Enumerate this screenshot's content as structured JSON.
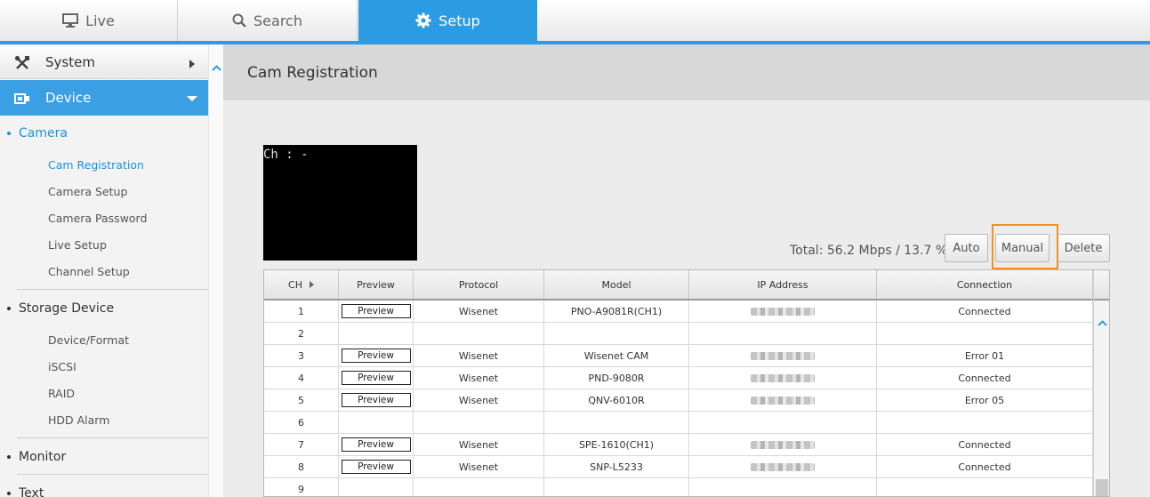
{
  "top_tabs": [
    {
      "label": "Live",
      "icon": "monitor-icon"
    },
    {
      "label": "Search",
      "icon": "search-icon"
    },
    {
      "label": "Setup",
      "icon": "gear-icon",
      "active": true
    }
  ],
  "sidebar": {
    "system_label": "System",
    "device_label": "Device",
    "groups": [
      {
        "label": "Camera",
        "active": true,
        "items": [
          "Cam Registration",
          "Camera Setup",
          "Camera Password",
          "Live Setup",
          "Channel Setup"
        ]
      },
      {
        "label": "Storage Device",
        "items": [
          "Device/Format",
          "iSCSI",
          "RAID",
          "HDD Alarm"
        ]
      },
      {
        "label": "Monitor",
        "items": []
      },
      {
        "label": "Text",
        "items": []
      }
    ]
  },
  "main": {
    "title": "Cam Registration",
    "preview_label": "Ch : -",
    "total": "Total: 56.2 Mbps / 13.7 %",
    "buttons": {
      "auto": "Auto",
      "manual": "Manual",
      "delete": "Delete"
    }
  },
  "table": {
    "columns": [
      "CH",
      "Preview",
      "Protocol",
      "Model",
      "IP Address",
      "Connection"
    ],
    "preview_button_label": "Preview",
    "rows": [
      {
        "ch": "1",
        "has_preview": true,
        "protocol": "Wisenet",
        "model": "PNO-A9081R(CH1)",
        "ip_blurred": true,
        "connection": "Connected"
      },
      {
        "ch": "2",
        "has_preview": false,
        "protocol": "",
        "model": "",
        "ip_blurred": false,
        "connection": ""
      },
      {
        "ch": "3",
        "has_preview": true,
        "protocol": "Wisenet",
        "model": "Wisenet CAM",
        "ip_blurred": true,
        "connection": "Error 01"
      },
      {
        "ch": "4",
        "has_preview": true,
        "protocol": "Wisenet",
        "model": "PND-9080R",
        "ip_blurred": true,
        "connection": "Connected"
      },
      {
        "ch": "5",
        "has_preview": true,
        "protocol": "Wisenet",
        "model": "QNV-6010R",
        "ip_blurred": true,
        "connection": "Error 05"
      },
      {
        "ch": "6",
        "has_preview": false,
        "protocol": "",
        "model": "",
        "ip_blurred": false,
        "connection": ""
      },
      {
        "ch": "7",
        "has_preview": true,
        "protocol": "Wisenet",
        "model": "SPE-1610(CH1)",
        "ip_blurred": true,
        "connection": "Connected"
      },
      {
        "ch": "8",
        "has_preview": true,
        "protocol": "Wisenet",
        "model": "SNP-L5233",
        "ip_blurred": true,
        "connection": "Connected"
      },
      {
        "ch": "9",
        "has_preview": false,
        "protocol": "",
        "model": "",
        "ip_blurred": false,
        "connection": ""
      }
    ]
  },
  "colors": {
    "accent": "#2b9be3",
    "highlight": "#f39221"
  }
}
